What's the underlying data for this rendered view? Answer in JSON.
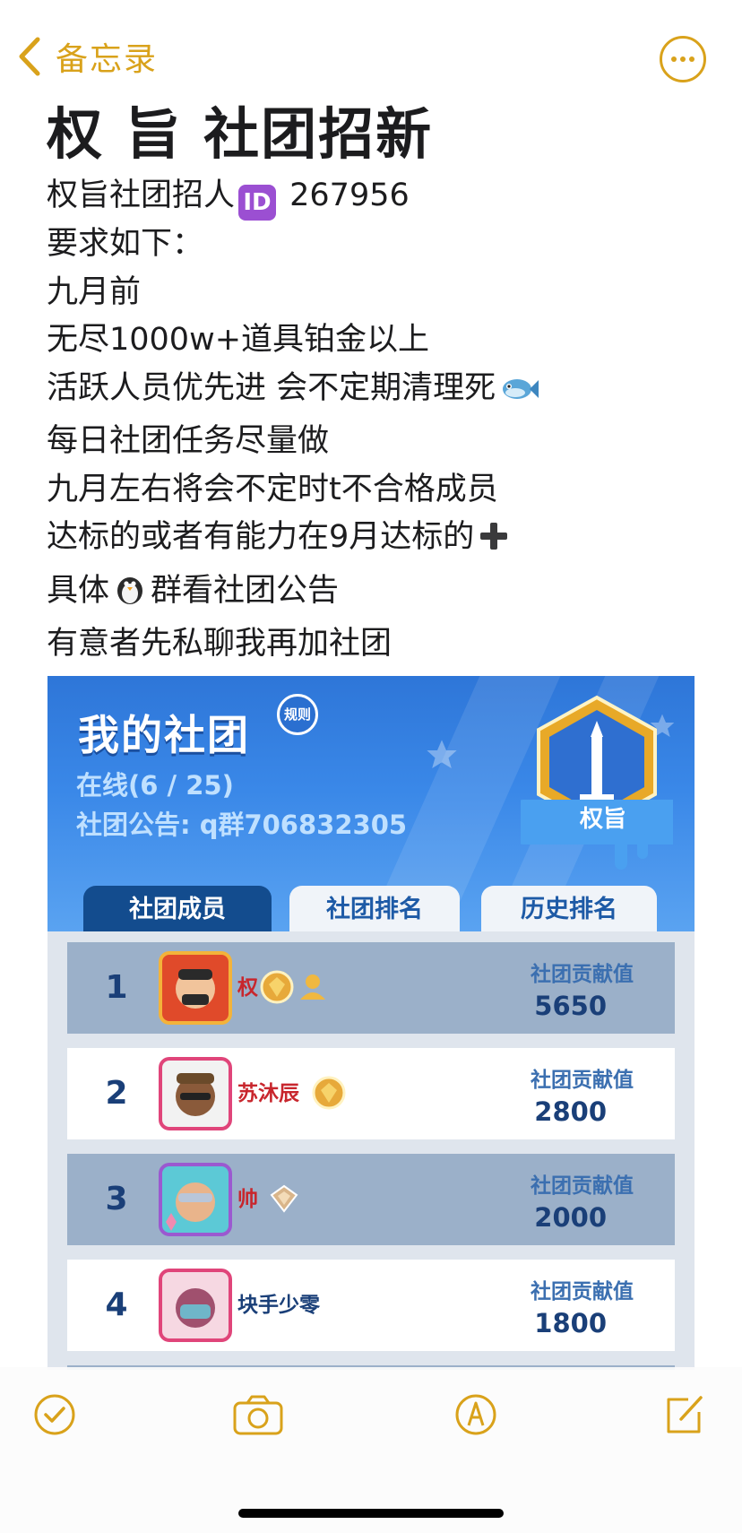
{
  "nav": {
    "back_label": "备忘录",
    "more_icon": "ellipsis-circle-icon",
    "accent_color": "#d9a21b"
  },
  "note": {
    "title": "权 旨 社团招新",
    "lines": [
      {
        "before": "权旨社团招人",
        "emoji": "ID",
        "after": " 267956"
      },
      {
        "text": "要求如下："
      },
      {
        "text": "九月前"
      },
      {
        "text": "无尽1000w+道具铂金以上"
      },
      {
        "text": "活跃人员优先进 会不定期清理死",
        "emoji_icon": "fish-icon"
      },
      {
        "text": "每日社团任务尽量做"
      },
      {
        "text": "九月左右将会不定时t不合格成员"
      },
      {
        "text": "达标的或者有能力在9月达标的",
        "emoji_icon": "plus-icon"
      },
      {
        "before": "具体",
        "emoji_icon": "penguin-icon",
        "after": "群看社团公告"
      },
      {
        "text": "有意者先私聊我再加社团"
      }
    ]
  },
  "game": {
    "title": "我的社团",
    "rules_label": "规则",
    "online": "在线(6 / 25)",
    "notice": "社团公告: q群706832305",
    "club_name": "权旨",
    "tabs": [
      "社团成员",
      "社团排名",
      "历史排名"
    ],
    "active_tab": 0,
    "contrib_label": "社团贡献值",
    "members": [
      {
        "rank": "1",
        "name": "权",
        "contribution": "5650",
        "badge": "diamond-badge-icon",
        "extra": "friend-icon"
      },
      {
        "rank": "2",
        "name": "苏沐辰",
        "contribution": "2800",
        "badge": "diamond-badge-icon"
      },
      {
        "rank": "3",
        "name": "帅",
        "contribution": "2000",
        "badge": "platinum-badge-icon"
      },
      {
        "rank": "4",
        "name": "块手少零",
        "contribution": "1800"
      }
    ]
  },
  "toolbar": {
    "icons": [
      "checklist-icon",
      "camera-icon",
      "markup-icon",
      "compose-icon"
    ]
  }
}
